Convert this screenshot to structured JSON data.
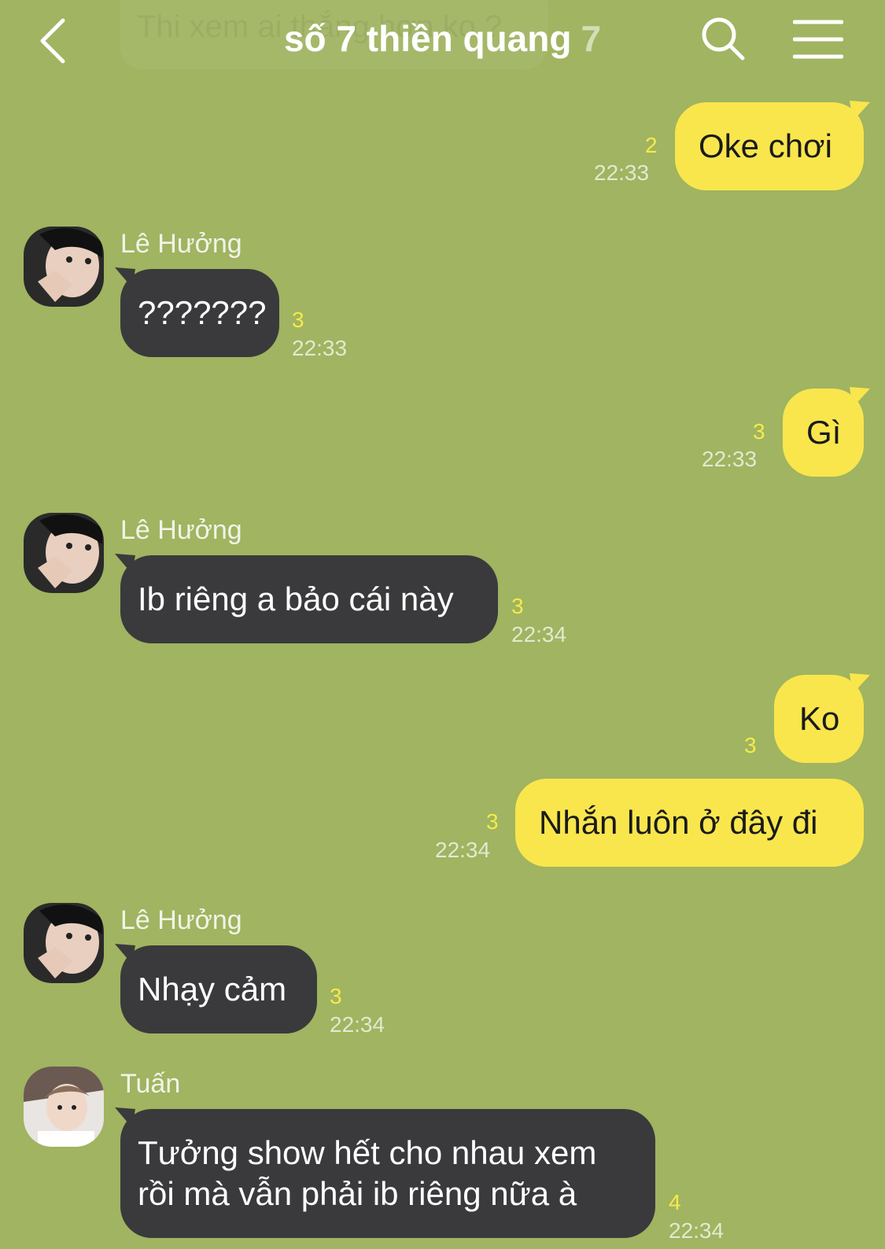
{
  "header": {
    "ghost_text": "Thi xem ai thắng hơn ko ?",
    "title": "số 7 thiền quang",
    "member_count": "7"
  },
  "colors": {
    "background": "#a0b461",
    "my_bubble": "#f9e64d",
    "their_bubble": "#3a3a3c",
    "unread": "#f6ea4a"
  },
  "icons": [
    "back-arrow-icon",
    "search-icon",
    "menu-icon"
  ],
  "messages": [
    {
      "sender": "",
      "text": "Oke chơi",
      "unread": "2",
      "time": "22:33",
      "mine": true
    },
    {
      "sender": "Lê Hưởng",
      "text": "???????",
      "unread": "3",
      "time": "22:33",
      "mine": false
    },
    {
      "sender": "",
      "text": "Gì",
      "unread": "3",
      "time": "22:33",
      "mine": true
    },
    {
      "sender": "Lê Hưởng",
      "text": "Ib riêng a bảo cái này",
      "unread": "3",
      "time": "22:34",
      "mine": false
    },
    {
      "sender": "",
      "text": "Ko",
      "unread": "3",
      "time": "",
      "mine": true
    },
    {
      "sender": "",
      "text": "Nhắn luôn ở đây đi",
      "unread": "3",
      "time": "22:34",
      "mine": true
    },
    {
      "sender": "Lê Hưởng",
      "text": "Nhạy cảm",
      "unread": "3",
      "time": "22:34",
      "mine": false
    },
    {
      "sender": "Tuấn",
      "text_lines": [
        "Tưởng show hết cho nhau xem",
        "rồi mà vẫn phải ib riêng nữa à"
      ],
      "unread": "4",
      "time": "22:34",
      "mine": false
    }
  ]
}
